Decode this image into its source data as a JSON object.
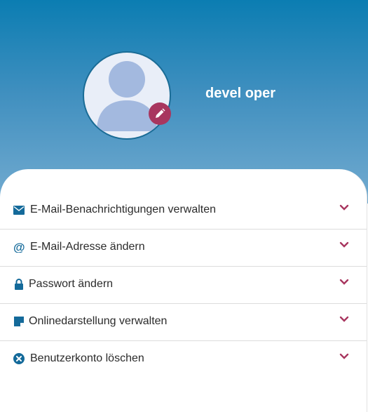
{
  "profile": {
    "username": "devel oper"
  },
  "menu": {
    "items": [
      {
        "label": "E-Mail-Benachrichtigungen verwalten",
        "icon": "envelope-icon"
      },
      {
        "label": "E-Mail-Adresse ändern",
        "icon": "at-sign-icon"
      },
      {
        "label": "Passwort ändern",
        "icon": "lock-icon"
      },
      {
        "label": "Onlinedarstellung verwalten",
        "icon": "note-icon"
      },
      {
        "label": "Benutzerkonto löschen",
        "icon": "circle-x-icon"
      }
    ]
  },
  "colors": {
    "hero_top": "#0b7db2",
    "hero_bottom": "#73abd0",
    "accent": "#a8365f",
    "icon_blue": "#146a9a"
  }
}
